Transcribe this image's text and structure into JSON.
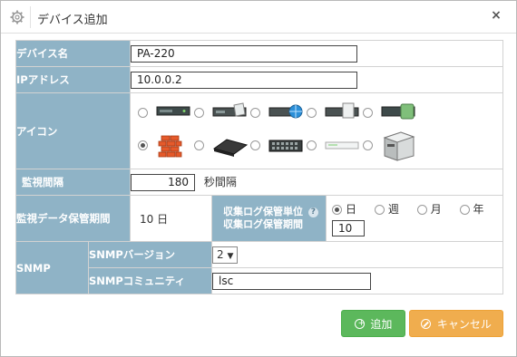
{
  "dialog": {
    "title": "デバイス追加",
    "close_label": "×"
  },
  "form": {
    "device_name": {
      "label": "デバイス名",
      "value": "PA-220"
    },
    "ip_address": {
      "label": "IPアドレス",
      "value": "10.0.0.2"
    },
    "icon": {
      "label": "アイコン",
      "options": [
        {
          "icon": "rack-server-icon",
          "checked": false
        },
        {
          "icon": "router-box-icon",
          "checked": false
        },
        {
          "icon": "switch-globe-icon",
          "checked": false
        },
        {
          "icon": "cloud-server-icon",
          "checked": false
        },
        {
          "icon": "storage-server-icon",
          "checked": false
        },
        {
          "icon": "firewall-icon",
          "checked": true
        },
        {
          "icon": "black-router-icon",
          "checked": false
        },
        {
          "icon": "network-switch-icon",
          "checked": false
        },
        {
          "icon": "white-switch-icon",
          "checked": false
        },
        {
          "icon": "tower-server-icon",
          "checked": false
        }
      ]
    },
    "monitor_interval": {
      "label": "監視間隔",
      "value": "180",
      "unit": "秒間隔"
    },
    "data_retention": {
      "label": "監視データ保管期間",
      "value": "10 日"
    },
    "log_unit": {
      "label_line1": "収集ログ保管単位",
      "label_line2": "収集ログ保管期間",
      "options": [
        "日",
        "週",
        "月",
        "年"
      ],
      "selected": "日",
      "period_value": "10"
    },
    "snmp": {
      "label": "SNMP",
      "version_label": "SNMPバージョン",
      "version_value": "2",
      "community_label": "SNMPコミュニティ",
      "community_value": "lsc"
    }
  },
  "buttons": {
    "add_label": "追加",
    "cancel_label": "キャンセル"
  },
  "colors": {
    "label_bg": "#8fb3c6",
    "add_button": "#5cb85c",
    "cancel_button": "#f0ad4e"
  }
}
